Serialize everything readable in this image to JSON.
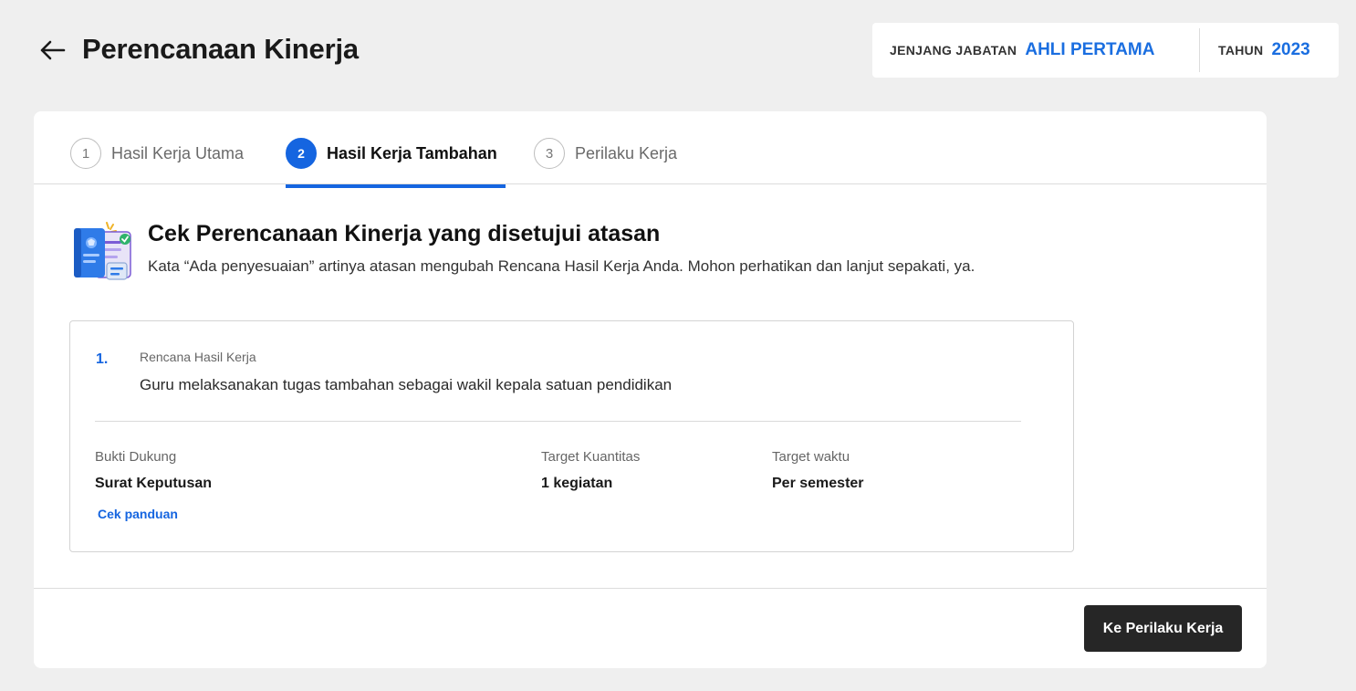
{
  "header": {
    "title": "Perencanaan Kinerja",
    "back_icon": "arrow-left-icon",
    "jenjang_label": "JENJANG JABATAN",
    "jenjang_value": "AHLI PERTAMA",
    "tahun_label": "TAHUN",
    "tahun_value": "2023"
  },
  "tabs": [
    {
      "number": "1",
      "label": "Hasil Kerja Utama",
      "active": false
    },
    {
      "number": "2",
      "label": "Hasil Kerja Tambahan",
      "active": true
    },
    {
      "number": "3",
      "label": "Perilaku Kerja",
      "active": false
    }
  ],
  "intro": {
    "icon": "document-check-illustration",
    "title": "Cek Perencanaan Kinerja yang disetujui atasan",
    "subtitle": "Kata “Ada penyesuaian” artinya atasan mengubah Rencana Hasil Kerja Anda. Mohon perhatikan dan lanjut sepakati, ya."
  },
  "plan": {
    "number": "1.",
    "label": "Rencana Hasil Kerja",
    "text": "Guru melaksanakan tugas tambahan sebagai wakil kepala satuan pendidikan",
    "bukti_label": "Bukti Dukung",
    "bukti_value": "Surat Keputusan",
    "guide_link": "Cek panduan",
    "kuantitas_label": "Target Kuantitas",
    "kuantitas_value": "1 kegiatan",
    "waktu_label": "Target waktu",
    "waktu_value": "Per semester"
  },
  "footer": {
    "next_label": "Ke Perilaku Kerja"
  },
  "colors": {
    "accent": "#1565e0",
    "button_dark": "#262626",
    "background": "#efefef"
  }
}
